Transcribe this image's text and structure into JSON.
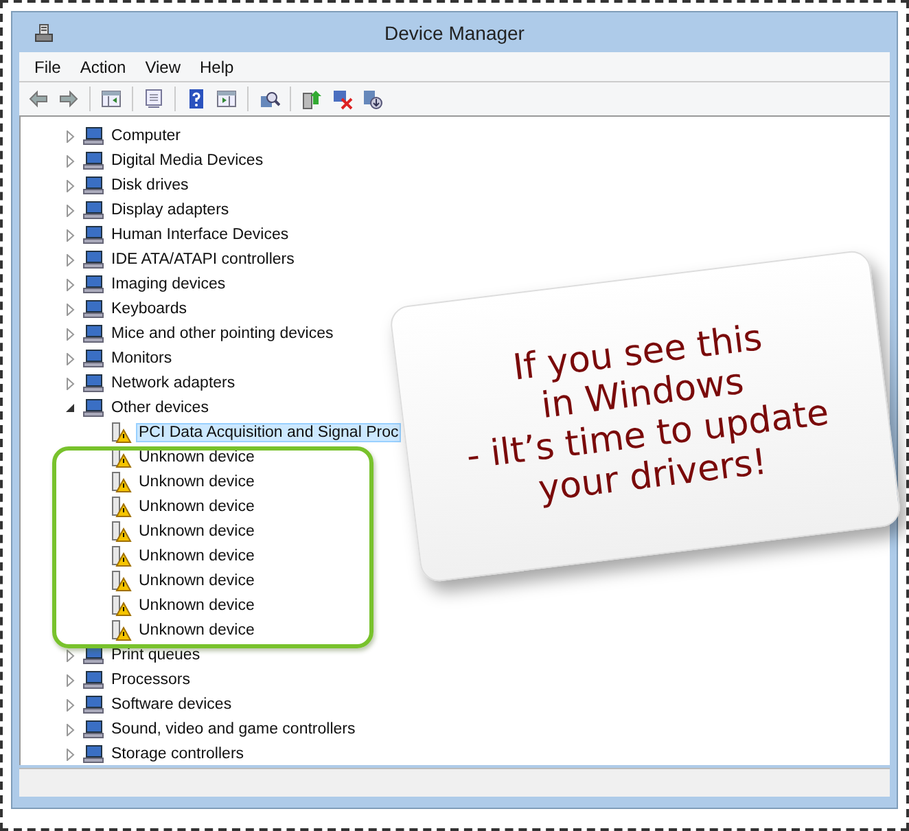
{
  "window": {
    "title": "Device Manager"
  },
  "menu": [
    "File",
    "Action",
    "View",
    "Help"
  ],
  "tree": [
    {
      "label": "Computer",
      "expanded": false
    },
    {
      "label": "Digital Media Devices",
      "expanded": false
    },
    {
      "label": "Disk drives",
      "expanded": false
    },
    {
      "label": "Display adapters",
      "expanded": false
    },
    {
      "label": "Human Interface Devices",
      "expanded": false
    },
    {
      "label": "IDE ATA/ATAPI controllers",
      "expanded": false
    },
    {
      "label": "Imaging devices",
      "expanded": false
    },
    {
      "label": "Keyboards",
      "expanded": false
    },
    {
      "label": "Mice and other pointing devices",
      "expanded": false
    },
    {
      "label": "Monitors",
      "expanded": false
    },
    {
      "label": "Network adapters",
      "expanded": false
    },
    {
      "label": "Other devices",
      "expanded": true,
      "children": [
        {
          "label": "PCI Data Acquisition and Signal Proc",
          "selected": true
        },
        {
          "label": "Unknown device",
          "selected": false
        },
        {
          "label": "Unknown device",
          "selected": false
        },
        {
          "label": "Unknown device",
          "selected": false
        },
        {
          "label": "Unknown device",
          "selected": false
        },
        {
          "label": "Unknown device",
          "selected": false
        },
        {
          "label": "Unknown device",
          "selected": false
        },
        {
          "label": "Unknown device",
          "selected": false
        },
        {
          "label": "Unknown device",
          "selected": false
        }
      ]
    },
    {
      "label": "Print queues",
      "expanded": false
    },
    {
      "label": "Processors",
      "expanded": false
    },
    {
      "label": "Software devices",
      "expanded": false
    },
    {
      "label": "Sound, video and game controllers",
      "expanded": false
    },
    {
      "label": "Storage controllers",
      "expanded": false
    }
  ],
  "callout": {
    "lines": [
      "If you see this",
      "in Windows",
      "- ilt’s time to update",
      "your drivers!"
    ]
  }
}
